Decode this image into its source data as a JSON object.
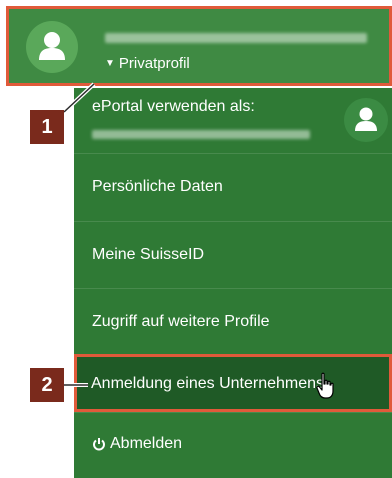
{
  "header": {
    "profile_toggle": "Privatprofil",
    "icons": {
      "avatar": "person-icon",
      "caret": "caret-down-icon"
    }
  },
  "menu": {
    "portal_label": "ePortal verwenden als:",
    "items": [
      "Persönliche Daten",
      "Meine SuisseID",
      "Zugriff auf weitere Profile",
      "Anmeldung eines Unternehmens"
    ],
    "logout_label": "Abmelden",
    "icons": {
      "portal_avatar": "person-icon",
      "logout": "power-icon"
    }
  },
  "callouts": {
    "badge_1": "1",
    "badge_2": "2"
  },
  "colors": {
    "menu_green": "#2f7a35",
    "header_green": "#3f8a43",
    "highlight_border": "#e05a3a",
    "badge_bg": "#7a2a1c",
    "selected_row": "#1f5a26"
  }
}
